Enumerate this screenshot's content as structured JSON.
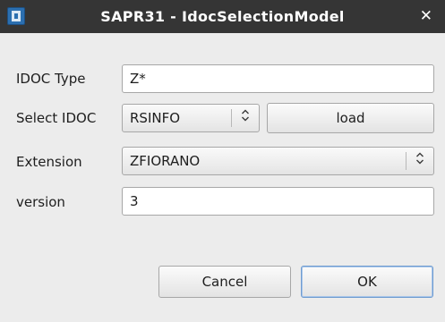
{
  "window": {
    "title": "SAPR31 - IdocSelectionModel",
    "close_glyph": "✕",
    "icon": "app-icon"
  },
  "form": {
    "idoc_type": {
      "label": "IDOC Type",
      "value": "Z*"
    },
    "select_idoc": {
      "label": "Select IDOC",
      "value": "RSINFO",
      "load_label": "load"
    },
    "extension": {
      "label": "Extension",
      "value": "ZFIORANO"
    },
    "version": {
      "label": "version",
      "value": "3"
    }
  },
  "buttons": {
    "cancel": "Cancel",
    "ok": "OK"
  },
  "icons": {
    "combo_arrows": "⌃⌄"
  },
  "colors": {
    "titlebar": "#353535",
    "background": "#ececec",
    "default_button_border": "#6e9bd0"
  }
}
